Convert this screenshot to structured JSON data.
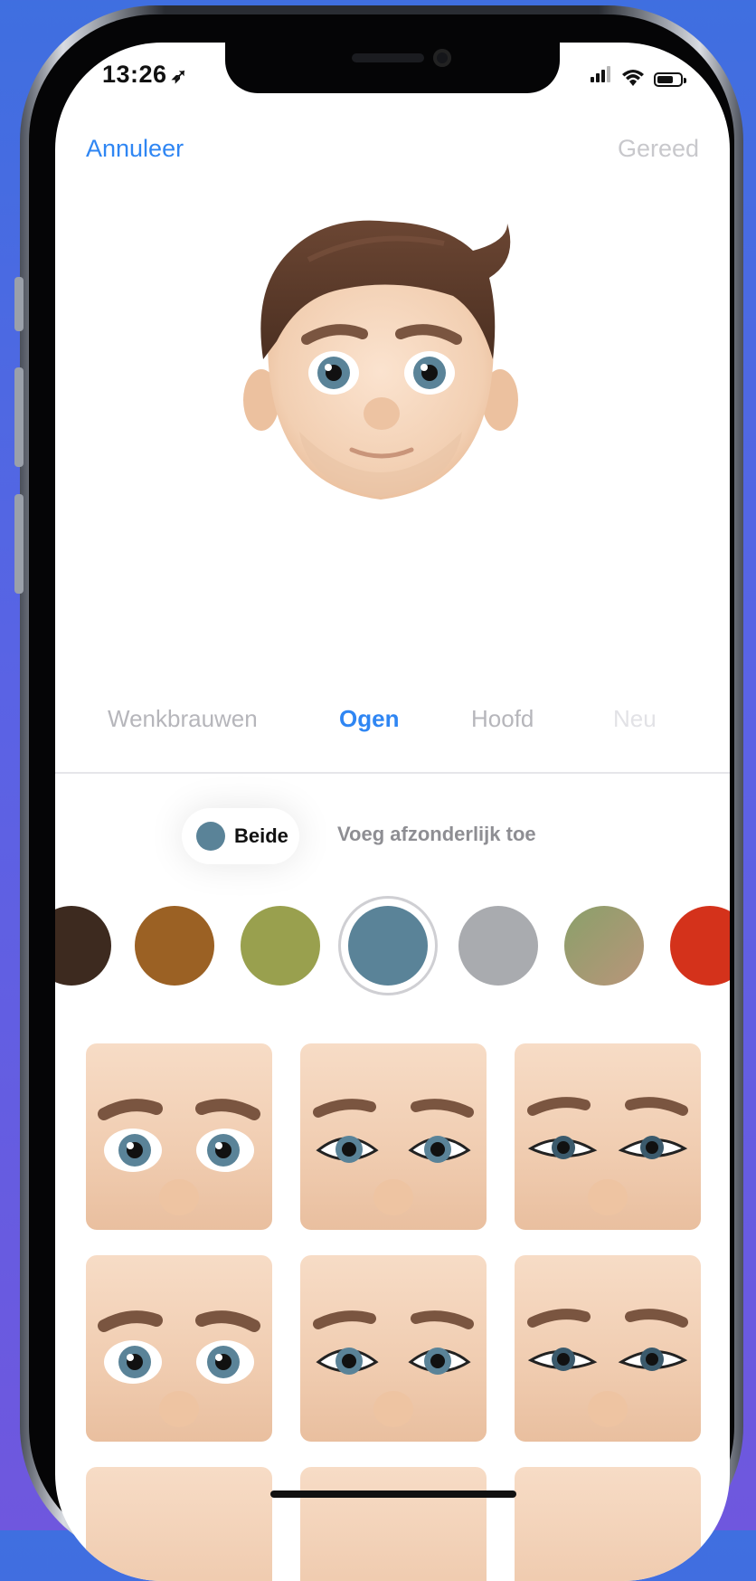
{
  "status_bar": {
    "time": "13:26",
    "location_icon": "location-arrow-icon",
    "icons": [
      "cellular-signal-icon",
      "wifi-icon",
      "battery-icon"
    ]
  },
  "nav": {
    "cancel_label": "Annuleer",
    "done_label": "Gereed"
  },
  "tabs": [
    {
      "label": "Wenkbrauwen",
      "active": false
    },
    {
      "label": "Ogen",
      "active": true
    },
    {
      "label": "Hoofd",
      "active": false
    },
    {
      "label": "Neu",
      "active": false
    }
  ],
  "eye_mode": {
    "selected_label": "Beide",
    "selected_color": "#5a8398",
    "alt_label": "Voeg afzonderlijk toe"
  },
  "eye_colors": [
    {
      "name": "dark-brown",
      "color": "#3d2a1f"
    },
    {
      "name": "amber",
      "color": "#9b6124"
    },
    {
      "name": "olive",
      "color": "#99a04e"
    },
    {
      "name": "blue-gray",
      "color": "#5a8398",
      "selected": true
    },
    {
      "name": "gray",
      "color": "#a9abaf"
    },
    {
      "name": "hazel",
      "color": "#9a9a70"
    },
    {
      "name": "red",
      "color": "#d4321b"
    }
  ],
  "eye_styles": [
    {
      "style": "round-lashless"
    },
    {
      "style": "almond-lashed"
    },
    {
      "style": "narrow-lashed"
    },
    {
      "style": "round-lashless"
    },
    {
      "style": "almond-lashed"
    },
    {
      "style": "narrow-lashed"
    }
  ],
  "colors": {
    "accent": "#2f86f3",
    "done_disabled": "#c8c8cc",
    "skin": "#f2d0b4",
    "hair": "#5a3a29"
  }
}
